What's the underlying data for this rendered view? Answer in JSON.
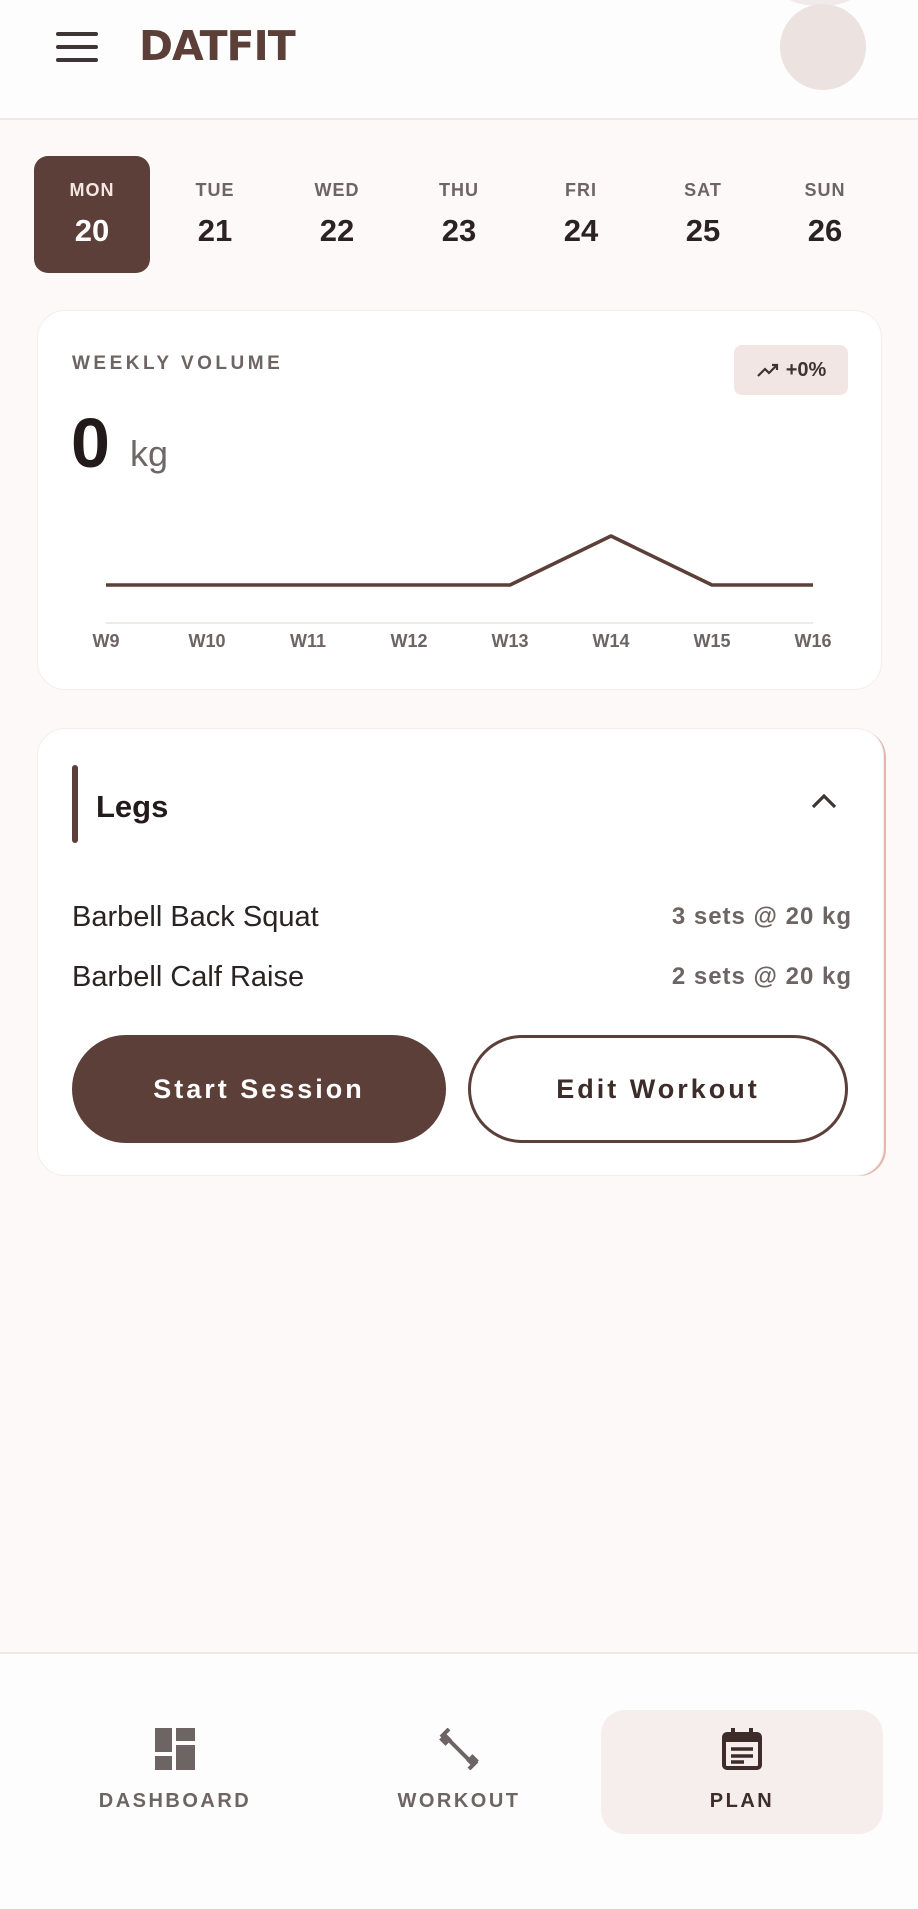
{
  "app": {
    "brand": "DATFIT",
    "icons": {
      "menu": "menu-icon",
      "avatar": "avatar"
    },
    "colors": {
      "primary": "#5b3f38",
      "background": "#fcf9f8",
      "muted_text": "#6d6464"
    }
  },
  "days": [
    {
      "name": "MON",
      "number": "20",
      "selected": true
    },
    {
      "name": "TUE",
      "number": "21",
      "selected": false
    },
    {
      "name": "WED",
      "number": "22",
      "selected": false
    },
    {
      "name": "THU",
      "number": "23",
      "selected": false
    },
    {
      "name": "FRI",
      "number": "24",
      "selected": false
    },
    {
      "name": "SAT",
      "number": "25",
      "selected": false
    },
    {
      "name": "SUN",
      "number": "26",
      "selected": false
    }
  ],
  "weekly_volume": {
    "title": "WEEKLY VOLUME",
    "value": "0",
    "unit": "kg",
    "trend": "+0%",
    "trend_icon": "trending-up-icon"
  },
  "chart_data": {
    "type": "line",
    "x": [
      "W9",
      "W10",
      "W11",
      "W12",
      "W13",
      "W14",
      "W15",
      "W16"
    ],
    "series": [
      {
        "values": [
          0,
          0,
          0,
          0,
          0,
          1,
          0,
          0
        ]
      }
    ],
    "grid": false,
    "color": "#5b3f38"
  },
  "workout": {
    "title": "Legs",
    "expand_icon": "chevron-up-icon",
    "exercises": [
      {
        "name": "Barbell Back Squat",
        "sets": "3 sets @ 20 kg"
      },
      {
        "name": "Barbell Calf Raise",
        "sets": "2 sets @ 20 kg"
      }
    ],
    "start_label": "Start Session",
    "edit_label": "Edit Workout"
  },
  "nav": {
    "items": [
      {
        "label": "DASHBOARD",
        "icon": "dashboard-icon",
        "active": false
      },
      {
        "label": "WORKOUT",
        "icon": "dumbbell-icon",
        "active": false
      },
      {
        "label": "PLAN",
        "icon": "calendar-icon",
        "active": true
      }
    ]
  }
}
